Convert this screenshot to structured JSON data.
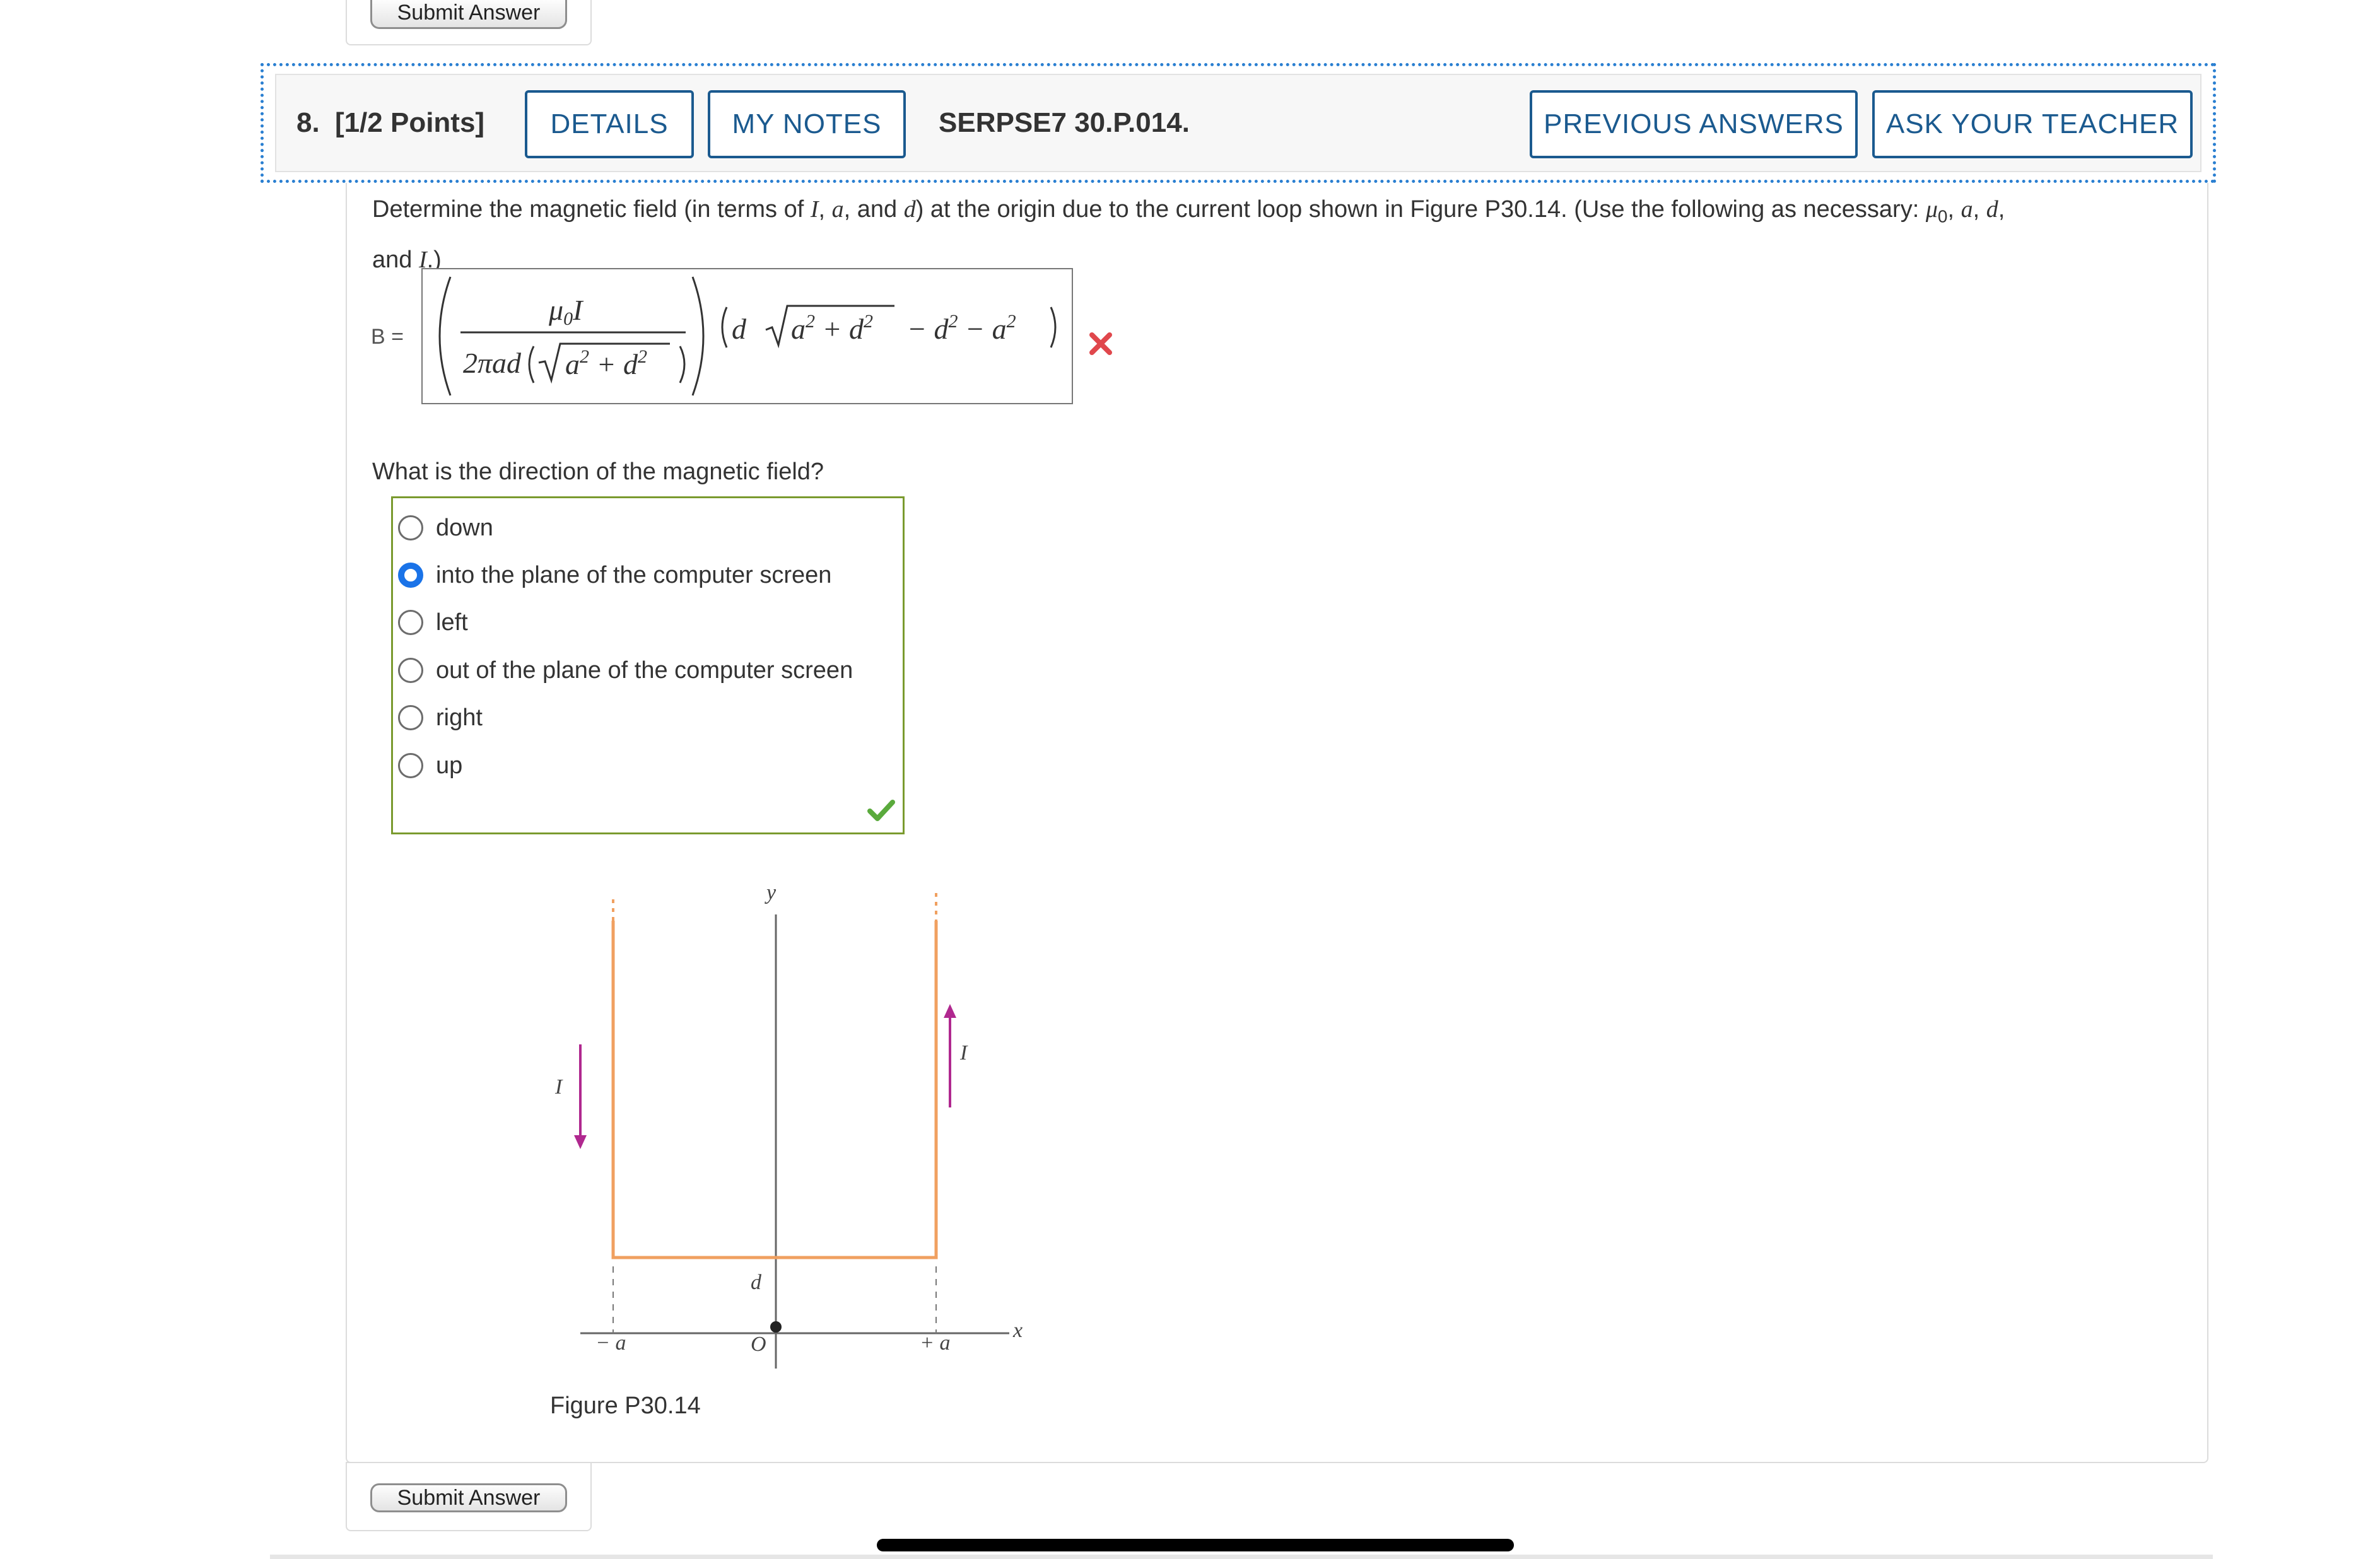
{
  "top": {
    "submit_label": "Submit Answer"
  },
  "header": {
    "number": "8.",
    "points": "[1/2 Points]",
    "details_label": "DETAILS",
    "my_notes_label": "MY NOTES",
    "code": "SERPSE7 30.P.014.",
    "previous_answers_label": "PREVIOUS ANSWERS",
    "ask_teacher_label": "ASK YOUR TEACHER"
  },
  "question": {
    "prompt_line1_a": "Determine the magnetic field (in terms of ",
    "prompt_I": "I",
    "prompt_line1_b": ", ",
    "prompt_a": "a",
    "prompt_line1_c": ", and ",
    "prompt_d": "d",
    "prompt_line1_d": ") at the origin due to the current loop shown in Figure P30.14. (Use the following as necessary: ",
    "prompt_mu": "μ",
    "prompt_mu_sub": "0",
    "prompt_line1_e": ", ",
    "prompt_line1_f": ", ",
    "prompt_line1_g": ",",
    "prompt_line2_a": "and ",
    "prompt_line2_b": ".)",
    "answer_label": "B =",
    "answer_status": "incorrect"
  },
  "direction": {
    "prompt": "What is the direction of the magnetic field?",
    "options": [
      "down",
      "into the plane of the computer screen",
      "left",
      "out of the plane of the computer screen",
      "right",
      "up"
    ],
    "selected": "into the plane of the computer screen",
    "status": "correct"
  },
  "figure": {
    "caption": "Figure P30.14",
    "label_y": "y",
    "label_x": "x",
    "label_I": "I",
    "label_d": "d",
    "label_O": "O",
    "label_neg_a": "− a",
    "label_pos_a": "+ a"
  },
  "bottom": {
    "submit_label": "Submit Answer"
  },
  "colors": {
    "accent_blue": "#1b5a8f",
    "focus_dotted": "#2a7fd1",
    "correct_green": "#5aaa3c",
    "incorrect_red": "#e0474c",
    "wire_orange": "#f0a060",
    "arrow_magenta": "#b0288f"
  }
}
